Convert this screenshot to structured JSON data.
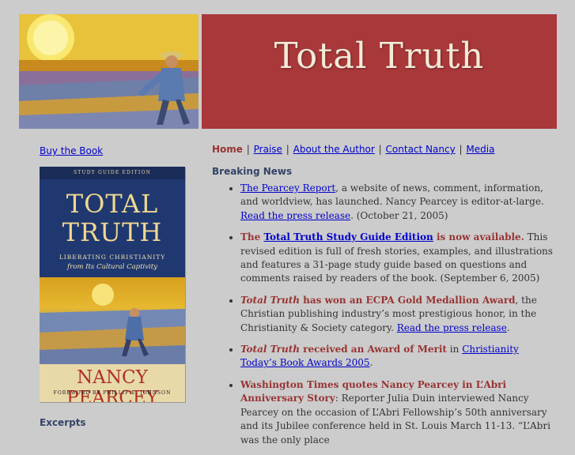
{
  "banner": {
    "title": "Total Truth"
  },
  "left": {
    "buy_link": "Buy the Book",
    "excerpts_heading": "Excerpts",
    "cover": {
      "edition": "STUDY GUIDE EDITION",
      "title_line1": "TOTAL",
      "title_line2": "TRUTH",
      "subtitle_line1": "LIBERATING CHRISTIANITY",
      "subtitle_line2": "from Its Cultural Captivity",
      "author": "NANCY PEARCEY",
      "foreword": "FOREWORD BY PHILLIP E. JOHNSON"
    }
  },
  "nav": {
    "items": [
      "Home",
      "Praise",
      "About the Author",
      "Contact Nancy",
      "Media"
    ],
    "separator": "|"
  },
  "news": {
    "heading": "Breaking News",
    "item1": {
      "link": "The Pearcey Report",
      "text": ", a website of news, comment, information, and worldview, has launched. Nancy Pearcey is editor-at-large. ",
      "link2": "Read the press release",
      "tail": ". (October 21, 2005)"
    },
    "item2": {
      "lead": "The ",
      "link": "Total Truth Study Guide Edition",
      "lead2": " is now available.",
      "text": " This revised edition is full of fresh stories, examples, and illustrations and features a 31-page study guide based on questions and comments raised by readers of the book. (September 6, 2005)"
    },
    "item3": {
      "title": "Total Truth",
      "lead": " has won an ECPA Gold Medallion Award",
      "text": ", the Christian publishing industry’s most prestigious honor, in the Christianity & Society category. ",
      "link": "Read the press release",
      "tail": "."
    },
    "item4": {
      "title": "Total Truth",
      "lead": " received an Award of Merit",
      "text": " in ",
      "link": "Christianity Today’s Book Awards 2005",
      "tail": "."
    },
    "item5": {
      "lead": "Washington Times quotes Nancy Pearcey in L’Abri Anniversary Story",
      "text": ": Reporter Julia Duin interviewed Nancy Pearcey on the occasion of L’Abri Fellowship’s 50th anniversary and its Jubilee conference held in St. Louis March 11-13. “L’Abri was the only place"
    }
  },
  "colors": {
    "background": "#cccccc",
    "banner_red": "#a8383a",
    "accent_red": "#993333",
    "link_blue": "#0000cc",
    "heading_blue": "#334466"
  }
}
